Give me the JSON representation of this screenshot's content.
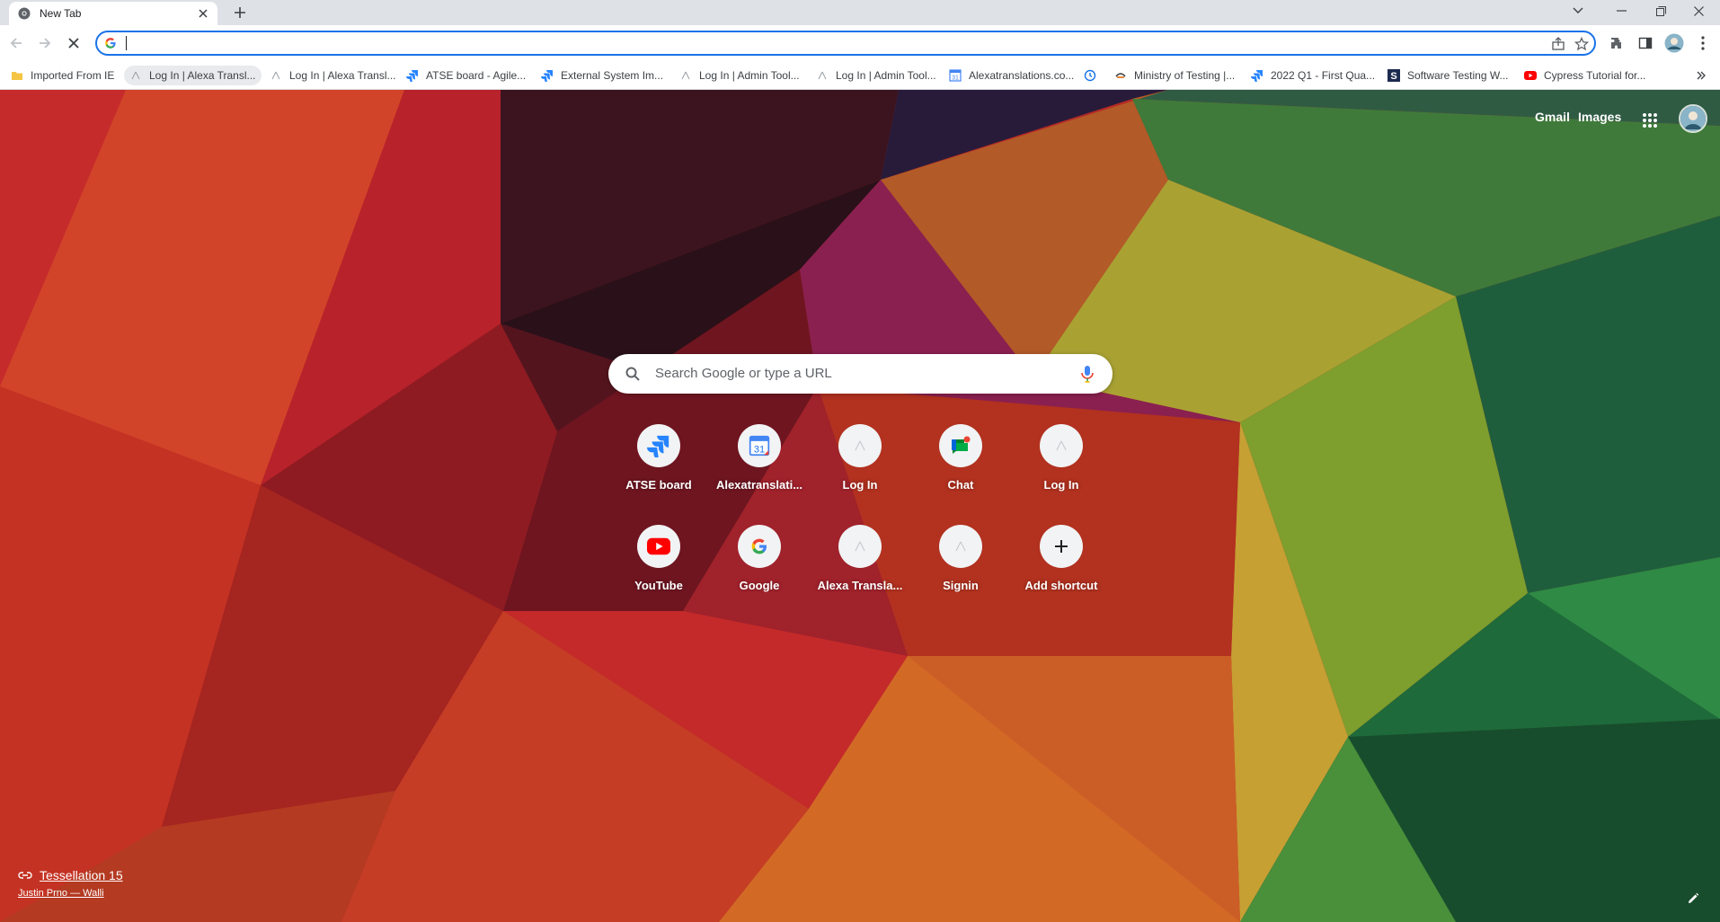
{
  "tab": {
    "title": "New Tab",
    "favicon": "chrome-icon"
  },
  "omnibox": {
    "value": "",
    "site_icon": "google-g-icon"
  },
  "bookmarks": [
    {
      "label": "Imported From IE",
      "icon": "folder-icon"
    },
    {
      "label": "Log In | Alexa Transl...",
      "icon": "globe-icon"
    },
    {
      "label": "Log In | Alexa Transl...",
      "icon": "globe-icon"
    },
    {
      "label": "ATSE board - Agile...",
      "icon": "jira-icon"
    },
    {
      "label": "External System Im...",
      "icon": "jira-icon"
    },
    {
      "label": "Log In | Admin Tool...",
      "icon": "globe-icon"
    },
    {
      "label": "Log In | Admin Tool...",
      "icon": "globe-icon"
    },
    {
      "label": "Alexatranslations.co...",
      "icon": "calendar-icon"
    },
    {
      "label": "",
      "icon": "history-icon"
    },
    {
      "label": "Ministry of Testing |...",
      "icon": "mot-icon"
    },
    {
      "label": "2022 Q1 - First Qua...",
      "icon": "jira-icon"
    },
    {
      "label": "Software Testing W...",
      "icon": "s-icon"
    },
    {
      "label": "Cypress Tutorial for...",
      "icon": "youtube-icon"
    }
  ],
  "header_links": {
    "gmail": "Gmail",
    "images": "Images"
  },
  "search": {
    "placeholder": "Search Google or type a URL"
  },
  "shortcuts": [
    {
      "label": "ATSE board",
      "icon": "jira-icon"
    },
    {
      "label": "Alexatranslati...",
      "icon": "calendar-icon"
    },
    {
      "label": "Log In",
      "icon": "globe-icon"
    },
    {
      "label": "Chat",
      "icon": "chat-icon"
    },
    {
      "label": "Log In",
      "icon": "globe-icon"
    },
    {
      "label": "YouTube",
      "icon": "youtube-icon"
    },
    {
      "label": "Google",
      "icon": "google-g-icon"
    },
    {
      "label": "Alexa Transla...",
      "icon": "globe-icon"
    },
    {
      "label": "Signin",
      "icon": "globe-icon"
    },
    {
      "label": "Add shortcut",
      "icon": "plus-icon"
    }
  ],
  "attribution": {
    "title": "Tessellation 15",
    "author": "Justin Prno — Walli"
  },
  "colors": {
    "accent": "#1a73e8",
    "tabstrip": "#dee1e6"
  }
}
